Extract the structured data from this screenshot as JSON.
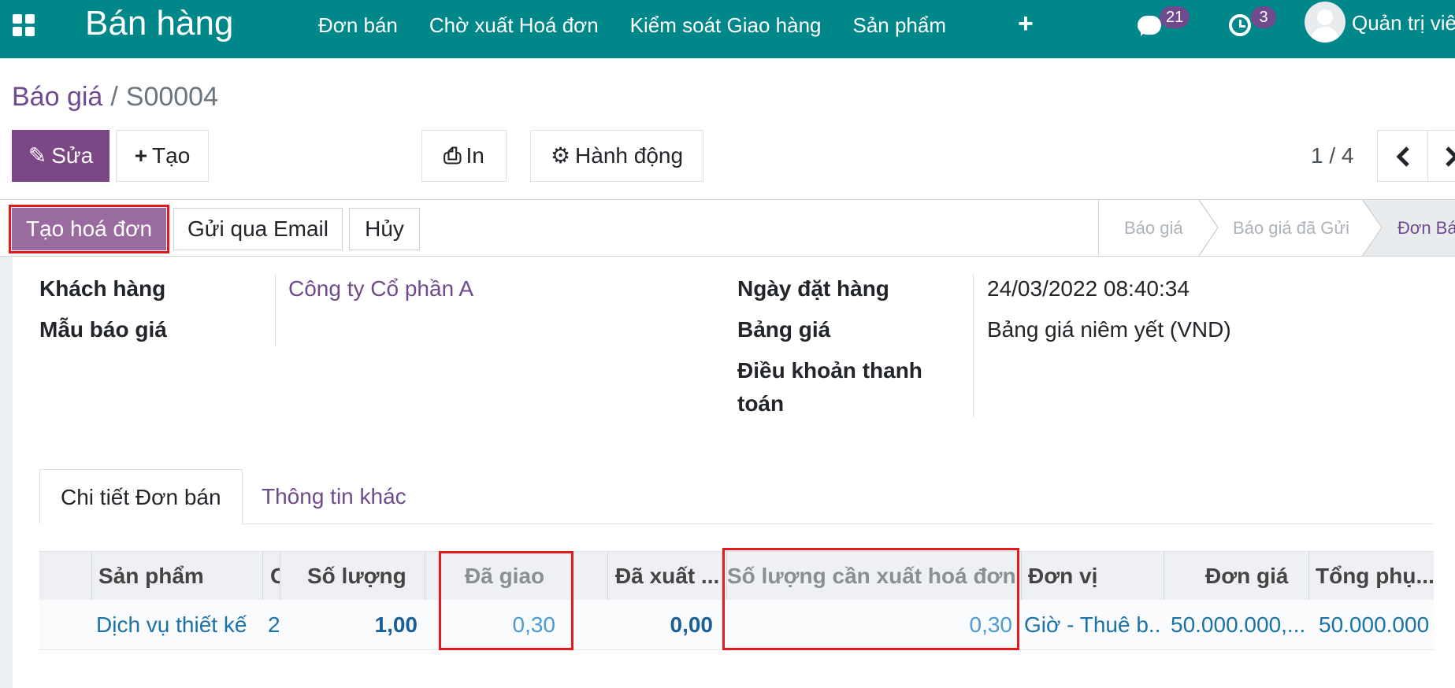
{
  "navbar": {
    "brand": "Bán hàng",
    "menu": [
      "Đơn bán",
      "Chờ xuất Hoá đơn",
      "Kiểm soát Giao hàng",
      "Sản phẩm"
    ],
    "messages_count": "21",
    "activities_count": "3",
    "user_name": "Quản trị viê"
  },
  "breadcrumb": {
    "parent": "Báo giá",
    "separator": "/",
    "current": "S00004"
  },
  "controls": {
    "edit_label": "Sửa",
    "create_label": "Tạo",
    "print_label": "In",
    "action_label": "Hành động",
    "pager": "1 / 4"
  },
  "statusbar": {
    "buttons": [
      "Tạo hoá đơn",
      "Gửi qua Email",
      "Hủy"
    ],
    "stages": [
      "Báo giá",
      "Báo giá đã Gửi",
      "Đơn Bán"
    ],
    "active_stage": "Đơn Bán"
  },
  "form": {
    "customer_label": "Khách hàng",
    "customer_value": "Công ty Cổ phần A",
    "template_label": "Mẫu báo giá",
    "order_date_label": "Ngày đặt hàng",
    "order_date_value": "24/03/2022 08:40:34",
    "pricelist_label": "Bảng giá",
    "pricelist_value": "Bảng giá niêm yết (VND)",
    "payment_terms_label_line1": "Điều khoản thanh",
    "payment_terms_label_line2": "toán"
  },
  "tabs": [
    "Chi tiết Đơn bán",
    "Thông tin khác"
  ],
  "table": {
    "headers": [
      "Sản phẩm",
      "C",
      "Số lượng",
      "Đã giao",
      "Đã xuất ...",
      "Số lượng cần xuất hoá đơn",
      "Đơn vị",
      "Đơn giá",
      "Tổng phụ..."
    ],
    "row": {
      "product": "Dịch vụ thiết kế",
      "desc": "2",
      "quantity": "1,00",
      "delivered": "0,30",
      "invoiced": "0,00",
      "to_invoice": "0,30",
      "uom": "Giờ - Thuê b...",
      "unit_price": "50.000.000,...",
      "subtotal": "50.000.000"
    }
  },
  "colors": {
    "navbar": "#00878a",
    "primary": "#7c4785",
    "link": "#6f4a8c",
    "highlight": "#e5181e"
  }
}
